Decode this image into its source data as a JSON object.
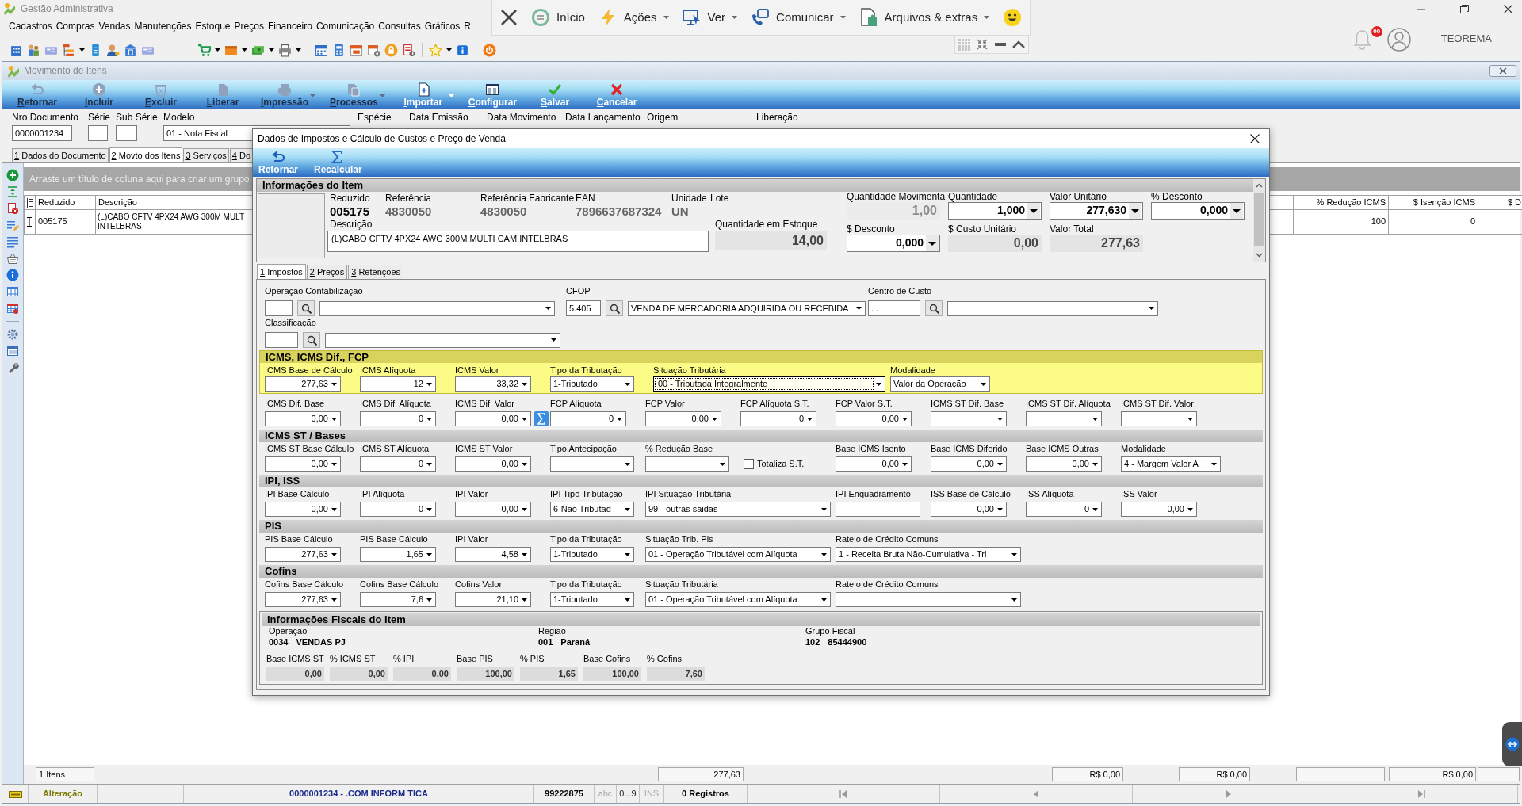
{
  "app": {
    "title": "Gestão Administrativa",
    "menu": [
      "Cadastros",
      "Compras",
      "Vendas",
      "Manutenções",
      "Estoque",
      "Preços",
      "Financeiro",
      "Comunicação",
      "Consultas",
      "Gráficos",
      "R"
    ],
    "notifications": "00",
    "user": "TEOREMA"
  },
  "quick_bar": {
    "items": [
      {
        "label": "Início",
        "has_menu": false
      },
      {
        "label": "Ações",
        "has_menu": true
      },
      {
        "label": "Ver",
        "has_menu": true
      },
      {
        "label": "Comunicar",
        "has_menu": true
      },
      {
        "label": "Arquivos & extras",
        "has_menu": true
      }
    ]
  },
  "window": {
    "title": "Movimento de Itens",
    "toolbar": [
      {
        "label": "Retornar",
        "disabled": true,
        "has_menu": false
      },
      {
        "label": "Incluir",
        "disabled": true,
        "has_menu": false
      },
      {
        "label": "Excluir",
        "disabled": true,
        "has_menu": false
      },
      {
        "label": "Liberar",
        "disabled": true,
        "has_menu": false
      },
      {
        "label": "Impressão",
        "disabled": true,
        "has_menu": true
      },
      {
        "label": "Processos",
        "disabled": true,
        "has_menu": true
      },
      {
        "label": "Importar",
        "disabled": false,
        "has_menu": true
      },
      {
        "label": "Configurar",
        "disabled": false,
        "has_menu": false
      },
      {
        "label": "Salvar",
        "disabled": false,
        "has_menu": false
      },
      {
        "label": "Cancelar",
        "disabled": false,
        "has_menu": false
      }
    ],
    "header_fields": [
      {
        "label": "Nro Documento",
        "kind": "text",
        "value": "0000001234"
      },
      {
        "label": "Série",
        "kind": "text"
      },
      {
        "label": "Sub Série",
        "kind": "text"
      },
      {
        "label": "Modelo",
        "kind": "select",
        "value": "01 - Nota Fiscal"
      }
    ],
    "header_labels": [
      "Espécie",
      "Data Emissão",
      "Data Movimento",
      "Data Lançamento",
      "Origem",
      "Liberação"
    ],
    "tabs": [
      {
        "label": "1 Dados do Documento",
        "selected": false
      },
      {
        "label": "2 Movto dos Itens",
        "selected": true
      },
      {
        "label": "3 Serviços",
        "selected": false
      },
      {
        "label": "4 Do",
        "selected": false
      }
    ],
    "grid": {
      "group_hint": "Arraste um título de coluna aqui para criar um grupo",
      "columns": [
        "Reduzido",
        "Descrição",
        "% Redução ICMS",
        "$ Isenção ICMS",
        "$ D"
      ],
      "rows": [
        {
          "cells": [
            "005175",
            "(L)CABO CFTV 4PX24 AWG 300M MULT\nINTELBRAS",
            "100",
            "0"
          ]
        }
      ],
      "footer": [
        "1 Itens",
        "277,63",
        "R$ 0,00",
        "R$ 0,00",
        "R$ 0,00"
      ]
    }
  },
  "dialog": {
    "title": "Dados de Impostos e Cálculo de Custos e Preço de Venda",
    "toolbar": [
      "Retornar",
      "Recalcular"
    ],
    "item_info": {
      "title": "Informações do Item",
      "attributes": [
        {
          "label": "Reduzido",
          "value": "005175",
          "muted": false
        },
        {
          "label": "Referência",
          "value": "4830050",
          "muted": true
        },
        {
          "label": "Referência Fabricante",
          "value": "4830050",
          "muted": true
        },
        {
          "label": "EAN",
          "value": "7896637687324",
          "muted": true
        },
        {
          "label": "Unidade",
          "value": "UN",
          "muted": true
        },
        {
          "label": "Lote"
        }
      ],
      "description": {
        "label": "Descrição",
        "value": "(L)CABO CFTV 4PX24 AWG 300M MULTI CAM INTELBRAS"
      },
      "stock": {
        "label": "Quantidade em Estoque",
        "value": "14,00"
      },
      "amounts": [
        {
          "label": "Quantidade Movimenta",
          "value": "1,00",
          "kind": "readonly",
          "disabled": true
        },
        {
          "label": "Quantidade",
          "value": "1,000",
          "kind": "number",
          "disabled": false
        },
        {
          "label": "Valor Unitário",
          "value": "277,630",
          "kind": "number",
          "disabled": false
        },
        {
          "label": "% Desconto",
          "value": "0,000",
          "kind": "number",
          "disabled": false
        },
        {
          "label": "$ Desconto",
          "value": "0,000",
          "kind": "number",
          "disabled": false
        },
        {
          "label": "$ Custo Unitário",
          "value": "0,00",
          "kind": "readonly",
          "disabled": false
        },
        {
          "label": "Valor Total",
          "value": "277,63",
          "kind": "readonly",
          "disabled": false
        }
      ]
    },
    "tabs": [
      {
        "label": "1 Impostos",
        "selected": true
      },
      {
        "label": "2 Preços",
        "selected": false
      },
      {
        "label": "3 Retenções",
        "selected": false
      }
    ],
    "lookups": [
      {
        "label": "Operação Contabilização"
      },
      {
        "label": "CFOP",
        "code": "5.405",
        "value": "VENDA DE MERCADORIA ADQUIRIDA OU RECEBIDA"
      },
      {
        "label": "Centro de Custo",
        "code": ". ."
      },
      {
        "label": "Classificação"
      }
    ],
    "sections": [
      {
        "title": "ICMS, ICMS Dif., FCP",
        "highlighted": true,
        "rows": [
          [
            {
              "label": "ICMS Base de Cálculo",
              "value": "277,63",
              "kind": "number",
              "focused": false
            },
            {
              "label": "ICMS Alíquota",
              "value": "12",
              "kind": "number",
              "focused": false
            },
            {
              "label": "ICMS Valor",
              "value": "33,32",
              "kind": "number",
              "focused": false
            },
            {
              "label": "Tipo da Tributação",
              "value": "1-Tributado",
              "kind": "select",
              "focused": false
            },
            {
              "label": "Situação Tributária",
              "value": "00 - Tributada Integralmente",
              "kind": "wide_select",
              "focused": true
            },
            {
              "label": "Modalidade",
              "value": "Valor da Operação",
              "kind": "select",
              "focused": false
            }
          ],
          [
            {
              "label": "ICMS Dif. Base",
              "value": "0,00",
              "kind": "number"
            },
            {
              "label": "ICMS Dif. Alíquota",
              "value": "0",
              "kind": "number"
            },
            {
              "label": "ICMS Dif. Valor",
              "value": "0,00",
              "kind": "number_calc"
            },
            {
              "label": "FCP Alíquota",
              "value": "0",
              "kind": "number"
            },
            {
              "label": "FCP Valor",
              "value": "0,00",
              "kind": "number"
            },
            {
              "label": "FCP Alíquota S.T.",
              "value": "0",
              "kind": "number"
            },
            {
              "label": "FCP Valor S.T.",
              "value": "0,00",
              "kind": "number"
            },
            {
              "label": "ICMS ST Dif. Base",
              "kind": "number"
            },
            {
              "label": "ICMS ST Dif. Alíquota",
              "kind": "number"
            },
            {
              "label": "ICMS ST Dif. Valor",
              "kind": "number"
            }
          ]
        ]
      },
      {
        "title": "ICMS ST / Bases",
        "highlighted": false,
        "rows": [
          [
            {
              "label": "ICMS ST Base Cálculo",
              "value": "0,00",
              "kind": "number"
            },
            {
              "label": "ICMS ST Alíquota",
              "value": "0",
              "kind": "number"
            },
            {
              "label": "ICMS ST Valor",
              "value": "0,00",
              "kind": "number"
            },
            {
              "label": "Tipo Antecipação",
              "kind": "select"
            },
            {
              "label": "% Redução Base",
              "kind": "select"
            },
            {
              "label": "Totaliza S.T.",
              "kind": "checkbox",
              "checked": false
            },
            {
              "label": "Base ICMS Isento",
              "value": "0,00",
              "kind": "number"
            },
            {
              "label": "Base ICMS Diferido",
              "value": "0,00",
              "kind": "number"
            },
            {
              "label": "Base ICMS Outras",
              "value": "0,00",
              "kind": "number"
            },
            {
              "label": "Modalidade",
              "value": "4 - Margem Valor A",
              "kind": "select"
            }
          ]
        ]
      },
      {
        "title": "IPI, ISS",
        "highlighted": false,
        "rows": [
          [
            {
              "label": "IPI Base Cálculo",
              "value": "0,00",
              "kind": "number"
            },
            {
              "label": "IPI Alíquota",
              "value": "0",
              "kind": "number"
            },
            {
              "label": "IPI Valor",
              "value": "0,00",
              "kind": "number"
            },
            {
              "label": "IPI Tipo Tributação",
              "value": "6-Não Tributad",
              "kind": "select"
            },
            {
              "label": "IPI Situação Tributária",
              "value": "99 - outras saidas",
              "kind": "wide_select"
            },
            {
              "label": "IPI Enquadramento",
              "kind": "text"
            },
            {
              "label": "ISS Base de Cálculo",
              "value": "0,00",
              "kind": "number"
            },
            {
              "label": "ISS Alíquota",
              "value": "0",
              "kind": "number"
            },
            {
              "label": "ISS Valor",
              "value": "0,00",
              "kind": "number"
            }
          ]
        ]
      },
      {
        "title": "PIS",
        "highlighted": false,
        "rows": [
          [
            {
              "label": "PIS Base Cálculo",
              "value": "277,63",
              "kind": "number"
            },
            {
              "label": "PIS Base Cálculo",
              "value": "1,65",
              "kind": "number"
            },
            {
              "label": "IPI Valor",
              "value": "4,58",
              "kind": "number"
            },
            {
              "label": "Tipo da Tributação",
              "value": "1-Tributado",
              "kind": "select"
            },
            {
              "label": "Situação Trib. Pis",
              "value": "01 - Operação Tributável com Alíquota",
              "kind": "wide_select"
            },
            {
              "label": "Rateio de Crédito Comuns",
              "value": "1 - Receita Bruta Não-Cumulativa - Tri",
              "kind": "wide_select"
            }
          ]
        ]
      },
      {
        "title": "Cofins",
        "highlighted": false,
        "rows": [
          [
            {
              "label": "Cofins Base Cálculo",
              "value": "277,63",
              "kind": "number"
            },
            {
              "label": "Cofins Base Cálculo",
              "value": "7,6",
              "kind": "number"
            },
            {
              "label": "Cofins Valor",
              "value": "21,10",
              "kind": "number"
            },
            {
              "label": "Tipo da Tributação",
              "value": "1-Tributado",
              "kind": "select"
            },
            {
              "label": "Situação Tributária",
              "value": "01 - Operação Tributável com Alíquota",
              "kind": "wide_select"
            },
            {
              "label": "Rateio de Crédito Comuns",
              "kind": "wide_select"
            }
          ]
        ]
      }
    ],
    "fiscal_info": {
      "title": "Informações Fiscais do Item",
      "groups": [
        {
          "label": "Operação",
          "code": "0034",
          "name": "VENDAS PJ"
        },
        {
          "label": "Região",
          "code": "001",
          "name": "Paraná"
        },
        {
          "label": "Grupo Fiscal",
          "code": "102",
          "name": "85444900"
        }
      ],
      "totals": [
        {
          "label": "Base ICMS ST",
          "value": "0,00"
        },
        {
          "label": "% ICMS ST",
          "value": "0,00"
        },
        {
          "label": "% IPI",
          "value": "0,00"
        },
        {
          "label": "Base PIS",
          "value": "100,00"
        },
        {
          "label": "% PIS",
          "value": "1,65"
        },
        {
          "label": "Base Cofins",
          "value": "100,00"
        },
        {
          "label": "% Cofins",
          "value": "7,60"
        }
      ]
    }
  },
  "status_bar": {
    "mode": "Alteração",
    "document": "0000001234 - .COM INFORM TICA",
    "code": "99222875",
    "indicators": [
      {
        "label": "abc",
        "on": false
      },
      {
        "label": "0...9",
        "on": true
      },
      {
        "label": "INS",
        "on": false
      }
    ],
    "records": "0 Registros"
  }
}
